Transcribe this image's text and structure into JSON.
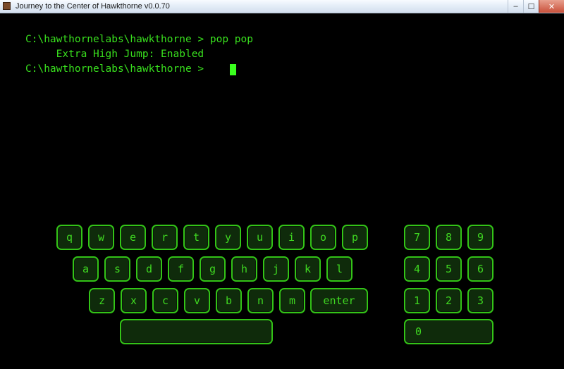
{
  "window": {
    "title": "Journey to the Center of Hawkthorne v0.0.70",
    "minimize": "–",
    "maximize": "☐",
    "close": "✕"
  },
  "terminal": {
    "lines": [
      "C:\\hawthornelabs\\hawkthorne > pop pop",
      "     Extra High Jump: Enabled",
      "C:\\hawthornelabs\\hawkthorne > "
    ]
  },
  "keyboard": {
    "row1": [
      "q",
      "w",
      "e",
      "r",
      "t",
      "y",
      "u",
      "i",
      "o",
      "p"
    ],
    "row2": [
      "a",
      "s",
      "d",
      "f",
      "g",
      "h",
      "j",
      "k",
      "l"
    ],
    "row3": [
      "z",
      "x",
      "c",
      "v",
      "b",
      "n",
      "m"
    ],
    "enter": "enter",
    "space": ""
  },
  "numpad": {
    "row1": [
      "7",
      "8",
      "9"
    ],
    "row2": [
      "4",
      "5",
      "6"
    ],
    "row3": [
      "1",
      "2",
      "3"
    ],
    "zero": "0"
  },
  "colors": {
    "text": "#39e01e",
    "key_border": "#33c417",
    "key_fill": "#0f2b0b",
    "background": "#000000"
  }
}
